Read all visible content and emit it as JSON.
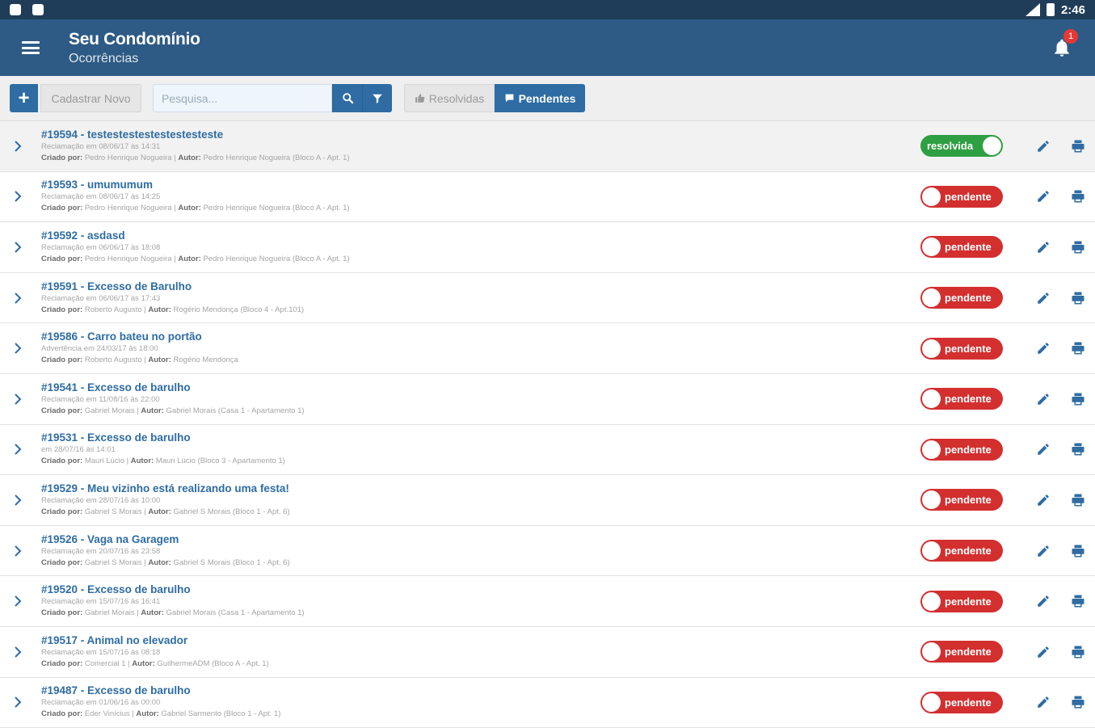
{
  "status_bar": {
    "time": "2:46"
  },
  "app_bar": {
    "title": "Seu Condomínio",
    "subtitle": "Ocorrências",
    "notification_count": "1"
  },
  "toolbar": {
    "add_icon": "plus-icon",
    "cadastrar_label": "Cadastrar Novo",
    "search_placeholder": "Pesquisa...",
    "resolvidas_label": "Resolvidas",
    "pendentes_label": "Pendentes"
  },
  "colors": {
    "primary": "#2e5b85",
    "accent": "#2e6ca3",
    "pending": "#d32f2f",
    "resolved": "#2ea043"
  },
  "labels": {
    "criado_por": "Criado por:",
    "autor": "Autor:"
  },
  "occurrences": [
    {
      "title": "#19594 - testestestestestestesteste",
      "line1": "Reclamação em 08/06/17 às 14:31",
      "created_by": "Pedro Henrique Nogueira",
      "author": "Pedro Henrique Nogueira (Bloco A - Apt. 1)",
      "status": "resolvida"
    },
    {
      "title": "#19593 - umumumum",
      "line1": "Reclamação em 08/06/17 às 14:25",
      "created_by": "Pedro Henrique Nogueira",
      "author": "Pedro Henrique Nogueira (Bloco A - Apt. 1)",
      "status": "pendente"
    },
    {
      "title": "#19592 - asdasd",
      "line1": "Reclamação em 06/06/17 às 18:08",
      "created_by": "Pedro Henrique Nogueira",
      "author": "Pedro Henrique Nogueira (Bloco A - Apt. 1)",
      "status": "pendente"
    },
    {
      "title": "#19591 - Excesso de Barulho",
      "line1": "Reclamação em 06/06/17 às 17:43",
      "created_by": "Roberto Augusto",
      "author": "Rogério Mendonça (Bloco 4 - Apt.101)",
      "status": "pendente"
    },
    {
      "title": "#19586 - Carro bateu no portão",
      "line1": "Advertência em 24/03/17 às 18:00",
      "created_by": "Roberto Augusto",
      "author": "Rogério Mendonça",
      "status": "pendente"
    },
    {
      "title": "#19541 - Excesso de barulho",
      "line1": "Reclamação em 11/08/16 às 22:00",
      "created_by": "Gabriel Morais",
      "author": "Gabriel Morais (Casa 1 - Apartamento 1)",
      "status": "pendente"
    },
    {
      "title": "#19531 - Excesso de barulho",
      "line1": "em 28/07/16 às 14:01",
      "created_by": "Mauri Lúcio",
      "author": "Mauri Lúcio (Bloco 3 - Apartamento 1)",
      "status": "pendente"
    },
    {
      "title": "#19529 - Meu vizinho está realizando uma festa!",
      "line1": "Reclamação em 28/07/16 às 10:00",
      "created_by": "Gabriel S Morais",
      "author": "Gabriel S Morais (Bloco 1 - Apt. 6)",
      "status": "pendente"
    },
    {
      "title": "#19526 - Vaga na Garagem",
      "line1": "Reclamação em 20/07/16 às 23:58",
      "created_by": "Gabriel S Morais",
      "author": "Gabriel S Morais (Bloco 1 - Apt. 6)",
      "status": "pendente"
    },
    {
      "title": "#19520 - Excesso de barulho",
      "line1": "Reclamação em 15/07/16 às 16:41",
      "created_by": "Gabriel Morais",
      "author": "Gabriel Morais (Casa 1 - Apartamento 1)",
      "status": "pendente"
    },
    {
      "title": "#19517 - Animal no elevador",
      "line1": "Reclamação em 15/07/16 às 08:18",
      "created_by": "Comercial 1",
      "author": "GuilhermeADM (Bloco A - Apt. 1)",
      "status": "pendente"
    },
    {
      "title": "#19487 - Excesso de barulho",
      "line1": "Reclamação em 01/06/16 às 00:00",
      "created_by": "Eder Vinícius",
      "author": "Gabriel Sarmento (Bloco 1 - Apt. 1)",
      "status": "pendente"
    }
  ]
}
